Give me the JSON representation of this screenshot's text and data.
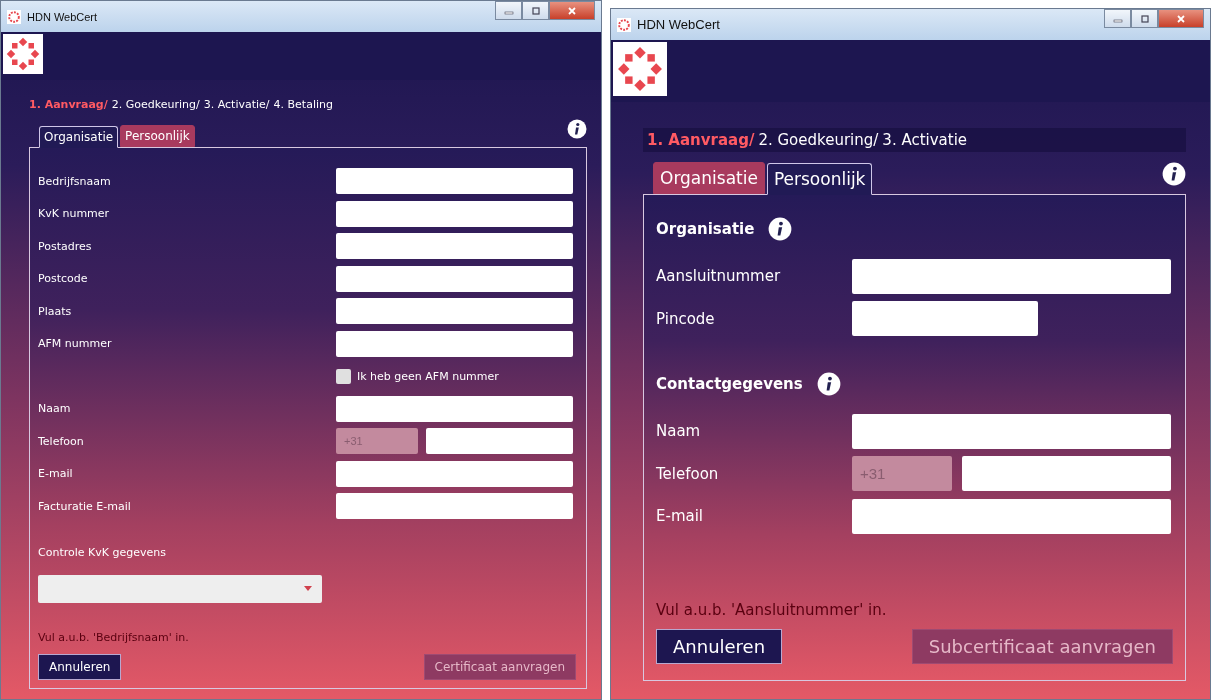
{
  "windows": [
    {
      "title": "HDN WebCert",
      "steps": [
        {
          "label": "1. Aanvraag/",
          "selected": true
        },
        {
          "label": "2. Goedkeuring/",
          "selected": false
        },
        {
          "label": "3. Activatie/",
          "selected": false
        },
        {
          "label": "4. Betaling",
          "selected": false
        }
      ],
      "tabs": [
        {
          "label": "Organisatie",
          "selected": true
        },
        {
          "label": "Persoonlijk",
          "selected": false
        }
      ],
      "groups": [
        {
          "rows": [
            {
              "kind": "text",
              "label": "Bedrijfsnaam"
            },
            {
              "kind": "text",
              "label": "KvK nummer"
            },
            {
              "kind": "text",
              "label": "Postadres"
            },
            {
              "kind": "text",
              "label": "Postcode"
            },
            {
              "kind": "text",
              "label": "Plaats"
            },
            {
              "kind": "text",
              "label": "AFM nummer"
            },
            {
              "kind": "checkbox",
              "label": "Ik heb geen AFM nummer",
              "checked": false
            },
            {
              "kind": "text",
              "label": "Naam"
            },
            {
              "kind": "phone",
              "label": "Telefoon",
              "prefix": "+31"
            },
            {
              "kind": "text",
              "label": "E-mail"
            },
            {
              "kind": "text",
              "label": "Facturatie E-mail"
            },
            {
              "kind": "select",
              "label": "Controle KvK gegevens"
            }
          ]
        }
      ],
      "error": "Vul a.u.b. 'Bedrijfsnaam' in.",
      "buttons": [
        {
          "label": "Annuleren",
          "disabled": false
        },
        {
          "label": "Certificaat aanvragen",
          "disabled": true
        }
      ]
    },
    {
      "title": "HDN WebCert",
      "steps": [
        {
          "label": "1. Aanvraag/",
          "selected": true
        },
        {
          "label": "2. Goedkeuring/",
          "selected": false
        },
        {
          "label": "3. Activatie",
          "selected": false
        }
      ],
      "tabs": [
        {
          "label": "Organisatie",
          "selected": false
        },
        {
          "label": "Persoonlijk",
          "selected": true
        }
      ],
      "groups": [
        {
          "heading": "Organisatie",
          "rows": [
            {
              "kind": "text",
              "label": "Aansluitnummer"
            },
            {
              "kind": "short",
              "label": "Pincode"
            }
          ]
        },
        {
          "heading": "Contactgegevens",
          "rows": [
            {
              "kind": "text",
              "label": "Naam"
            },
            {
              "kind": "phone",
              "label": "Telefoon",
              "prefix": "+31"
            },
            {
              "kind": "text",
              "label": "E-mail"
            }
          ]
        }
      ],
      "error": "Vul a.u.b. 'Aansluitnummer' in.",
      "buttons": [
        {
          "label": "Annuleren",
          "disabled": false
        },
        {
          "label": "Subcertificaat aanvragen",
          "disabled": true
        }
      ]
    }
  ]
}
